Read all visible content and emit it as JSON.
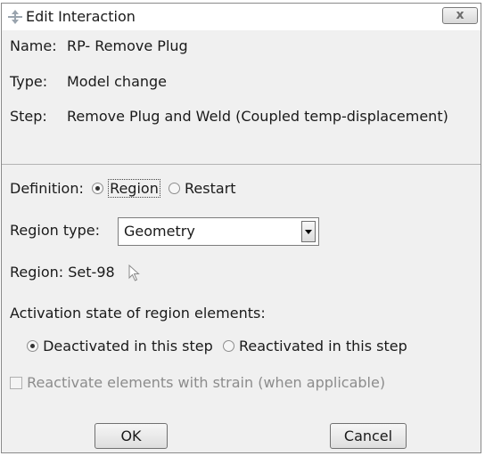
{
  "title": "Edit Interaction",
  "close_label": "x",
  "name": {
    "label": "Name:",
    "value": "RP- Remove Plug"
  },
  "type": {
    "label": "Type:",
    "value": "Model change"
  },
  "step": {
    "label": "Step:",
    "value": "Remove Plug and Weld (Coupled temp-displacement)"
  },
  "definition": {
    "label": "Definition:",
    "options": [
      "Region",
      "Restart"
    ],
    "selected": "Region"
  },
  "region_type": {
    "label": "Region type:",
    "value": "Geometry"
  },
  "region": {
    "label": "Region:",
    "value": "Set-98"
  },
  "activation": {
    "label": "Activation state of region elements:",
    "options": [
      "Deactivated in this step",
      "Reactivated in this step"
    ],
    "selected": "Deactivated in this step"
  },
  "reactivate_checkbox": {
    "label": "Reactivate elements with strain (when applicable)",
    "checked": false,
    "enabled": false
  },
  "buttons": {
    "ok": "OK",
    "cancel": "Cancel"
  },
  "icons": {
    "title": "move-arrows-icon",
    "pointer": "arrow-pointer-icon"
  }
}
